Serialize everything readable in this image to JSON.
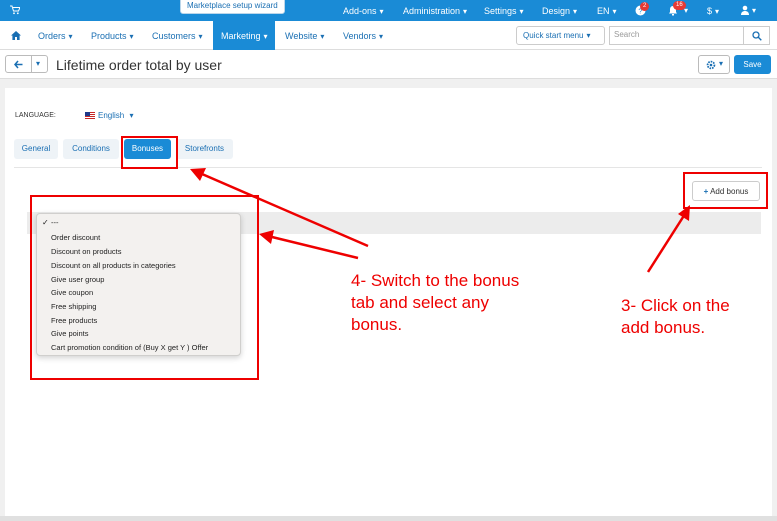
{
  "topbar": {
    "wizard": "Marketplace setup wizard",
    "items": [
      "Add-ons",
      "Administration",
      "Settings",
      "Design",
      "EN",
      "$"
    ],
    "badges": [
      "2",
      "16"
    ]
  },
  "nav": {
    "items": [
      "Orders",
      "Products",
      "Customers",
      "Marketing",
      "Website",
      "Vendors"
    ],
    "quick_start": "Quick start menu",
    "search_placeholder": "Search"
  },
  "page": {
    "title": "Lifetime order total by user",
    "save": "Save"
  },
  "language": {
    "label": "LANGUAGE:",
    "value": "English"
  },
  "tabs": [
    "General",
    "Conditions",
    "Bonuses",
    "Storefronts"
  ],
  "add_bonus": "Add bonus",
  "dropdown": {
    "selected": "---",
    "options": [
      "Order discount",
      "Discount on products",
      "Discount on all products in categories",
      "Give user group",
      "Give coupon",
      "Free shipping",
      "Free products",
      "Give points",
      "Cart promotion condition of (Buy X get Y ) Offer"
    ]
  },
  "annotations": {
    "step4": [
      "4- Switch to the bonus",
      "tab and select any",
      "bonus."
    ],
    "step3": [
      "3- Click on the",
      "add bonus."
    ]
  },
  "colors": {
    "primary": "#1a8bd6",
    "annotation": "#e00000"
  }
}
